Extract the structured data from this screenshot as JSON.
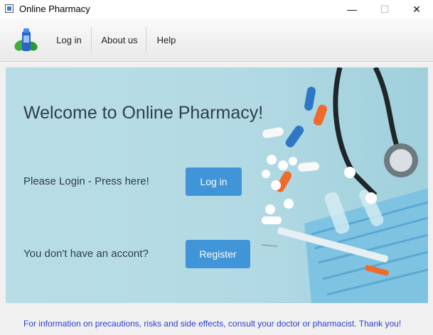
{
  "window": {
    "title": "Online Pharmacy",
    "controls": {
      "minimize": "—",
      "maximize": "☐",
      "close": "✕"
    }
  },
  "menu": {
    "logo_icon": "pharmacy-bottle-leaf-icon",
    "items": [
      {
        "label": "Log in"
      },
      {
        "label": "About us"
      },
      {
        "label": "Help"
      }
    ]
  },
  "hero": {
    "welcome": "Welcome to Online Pharmacy!",
    "login_prompt": "Please Login - Press here!",
    "login_button": "Log in",
    "register_prompt": "You don't have an accont?",
    "register_button": "Register"
  },
  "footer": {
    "notice": "For information on precautions, risks and side effects, consult your doctor or pharmacist. Thank you!"
  },
  "colors": {
    "accent_button": "#3f95d8",
    "hero_background": "#b3dae4",
    "footer_text": "#2a3ecb"
  }
}
